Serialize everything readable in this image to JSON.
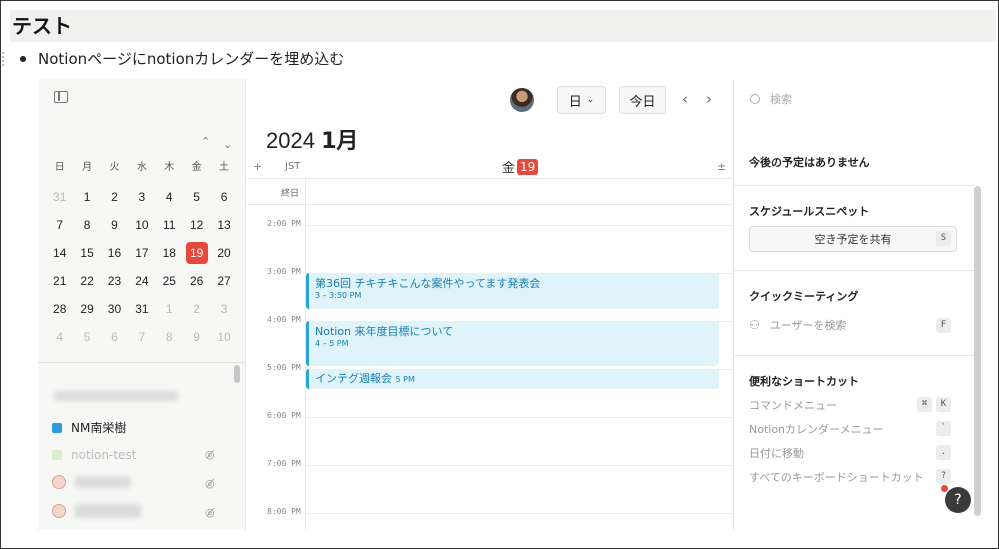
{
  "page": {
    "title": "テスト",
    "bullet": "Notionページにnotionカレンダーを埋め込む"
  },
  "sidebar": {
    "weekdays": [
      "日",
      "月",
      "火",
      "水",
      "木",
      "金",
      "土"
    ],
    "days": [
      {
        "d": "31",
        "other": true
      },
      {
        "d": "1"
      },
      {
        "d": "2"
      },
      {
        "d": "3"
      },
      {
        "d": "4"
      },
      {
        "d": "5"
      },
      {
        "d": "6"
      },
      {
        "d": "7"
      },
      {
        "d": "8"
      },
      {
        "d": "9"
      },
      {
        "d": "10"
      },
      {
        "d": "11"
      },
      {
        "d": "12"
      },
      {
        "d": "13"
      },
      {
        "d": "14"
      },
      {
        "d": "15"
      },
      {
        "d": "16"
      },
      {
        "d": "17"
      },
      {
        "d": "18"
      },
      {
        "d": "19",
        "today": true
      },
      {
        "d": "20"
      },
      {
        "d": "21"
      },
      {
        "d": "22"
      },
      {
        "d": "23"
      },
      {
        "d": "24"
      },
      {
        "d": "25"
      },
      {
        "d": "26"
      },
      {
        "d": "27"
      },
      {
        "d": "28"
      },
      {
        "d": "29"
      },
      {
        "d": "30"
      },
      {
        "d": "31"
      },
      {
        "d": "1",
        "other": true
      },
      {
        "d": "2",
        "other": true
      },
      {
        "d": "3",
        "other": true
      },
      {
        "d": "4",
        "other": true
      },
      {
        "d": "5",
        "other": true
      },
      {
        "d": "6",
        "other": true
      },
      {
        "d": "7",
        "other": true
      },
      {
        "d": "8",
        "other": true
      },
      {
        "d": "9",
        "other": true
      },
      {
        "d": "10",
        "other": true
      }
    ],
    "calendars": [
      {
        "label": "NM南栄樹",
        "color": "#2e9be0"
      },
      {
        "label": "notion-test",
        "color": "#d8eec9"
      }
    ]
  },
  "toolbar": {
    "view_label": "日",
    "today_label": "今日",
    "year": "2024",
    "month": "1月"
  },
  "grid": {
    "add": "+",
    "timezone": "JST",
    "day_name": "金",
    "day_number": "19",
    "collapse": "±",
    "allday_label": "終日",
    "hours": [
      "2:00 PM",
      "3:00 PM",
      "4:00 PM",
      "5:00 PM",
      "6:00 PM",
      "7:00 PM",
      "8:00 PM"
    ]
  },
  "events": [
    {
      "title": "第36回 チキチキこんな案件やってます発表会",
      "time": "3 – 3:50 PM"
    },
    {
      "title": "Notion 来年度目標について",
      "time": "4 – 5 PM"
    },
    {
      "title": "インテグ週報会",
      "time": "5 PM"
    }
  ],
  "right_panel": {
    "search_placeholder": "検索",
    "no_events": "今後の予定はありません",
    "snippet_title": "スケジュールスニペット",
    "share_label": "空き予定を共有",
    "share_key": "S",
    "quick_title": "クイックミーティング",
    "user_search": "ユーザーを検索",
    "user_key": "F",
    "shortcuts_title": "便利なショートカット",
    "shortcuts": [
      {
        "label": "コマンドメニュー",
        "keys": [
          "⌘",
          "K"
        ]
      },
      {
        "label": "Notionカレンダーメニュー",
        "keys": [
          "`"
        ]
      },
      {
        "label": "日付に移動",
        "keys": [
          "."
        ]
      },
      {
        "label": "すべてのキーボードショートカット",
        "keys": [
          "?"
        ]
      }
    ],
    "help": "?"
  },
  "colors": {
    "accent_red": "#e5483c",
    "event_bg": "#dff3fb",
    "event_border": "#2aa3d6"
  }
}
